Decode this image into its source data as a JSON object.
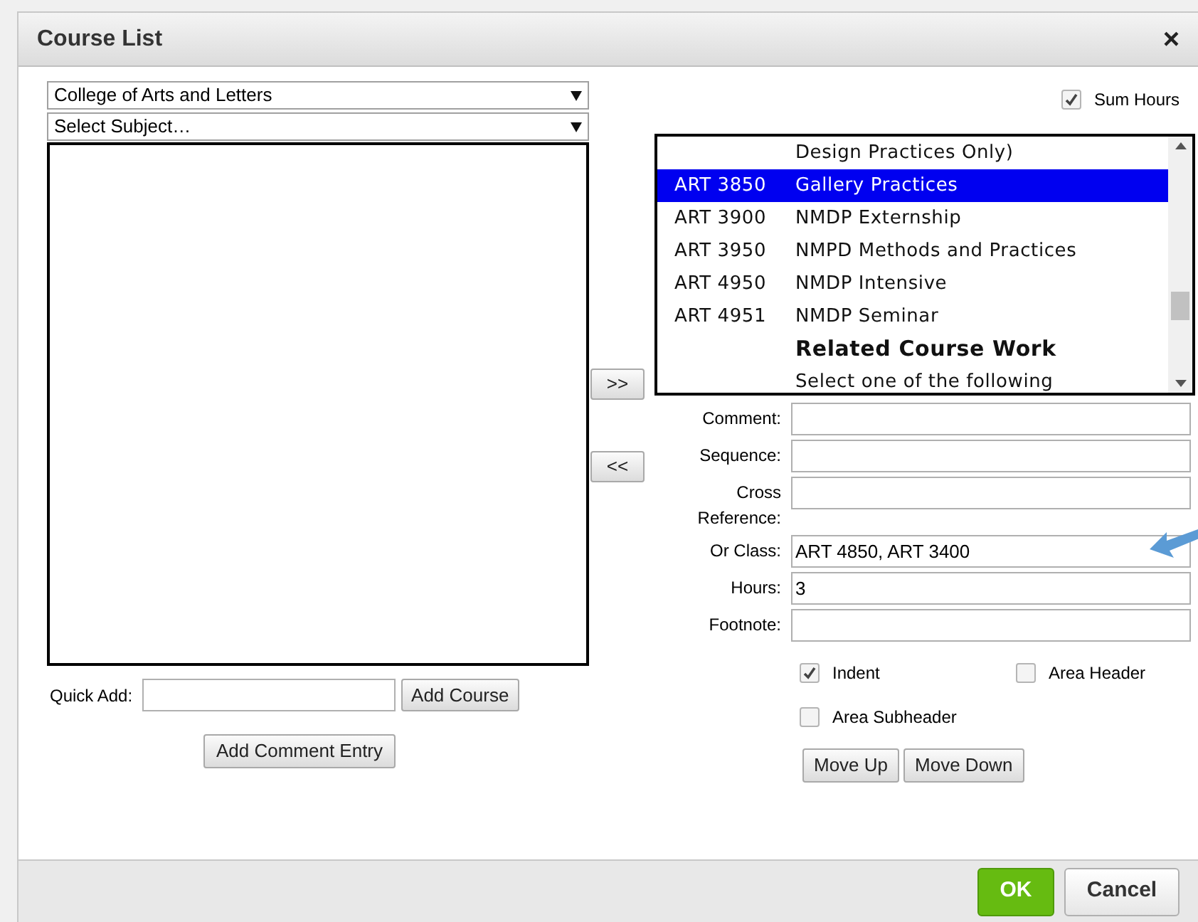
{
  "window": {
    "title": "Course List",
    "close": "×"
  },
  "college_select": {
    "value": "College of Arts and Letters"
  },
  "subject_select": {
    "value": "Select Subject…"
  },
  "sum_hours": {
    "label": "Sum Hours",
    "checked": true
  },
  "move_right": ">>",
  "move_left": "<<",
  "courses": [
    {
      "kind": "note",
      "title": "Design Practices Only)",
      "selected": false
    },
    {
      "kind": "course",
      "code": "ART 3850",
      "title": "Gallery Practices",
      "selected": true
    },
    {
      "kind": "course",
      "code": "ART 3900",
      "title": "NMDP Externship",
      "selected": false
    },
    {
      "kind": "course",
      "code": "ART 3950",
      "title": "NMPD Methods and Practices",
      "selected": false
    },
    {
      "kind": "course",
      "code": "ART 4950",
      "title": "NMDP Intensive",
      "selected": false
    },
    {
      "kind": "course",
      "code": "ART 4951",
      "title": "NMDP Seminar",
      "selected": false
    },
    {
      "kind": "heading",
      "title": "Related Course Work",
      "selected": false
    },
    {
      "kind": "note",
      "title": "Select one of the following",
      "selected": false
    }
  ],
  "fields": [
    {
      "label": "Comment:"
    },
    {
      "label": "Sequence:"
    },
    {
      "label": "Cross Reference:"
    },
    {
      "label": "Or Class:",
      "value": "ART 4850, ART 3400",
      "pointer": true
    },
    {
      "label": "Hours:",
      "value": "3"
    },
    {
      "label": "Footnote:"
    }
  ],
  "options": [
    {
      "label": "Indent",
      "checked": true
    },
    {
      "label": "Area Header",
      "checked": false
    },
    {
      "label": "Area Subheader",
      "checked": false
    }
  ],
  "quick_add": {
    "label": "Quick Add:"
  },
  "buttons": {
    "add_course": "Add Course",
    "add_comment": "Add Comment Entry",
    "move_up": "Move Up",
    "move_down": "Move Down",
    "ok": "OK",
    "cancel": "Cancel"
  }
}
